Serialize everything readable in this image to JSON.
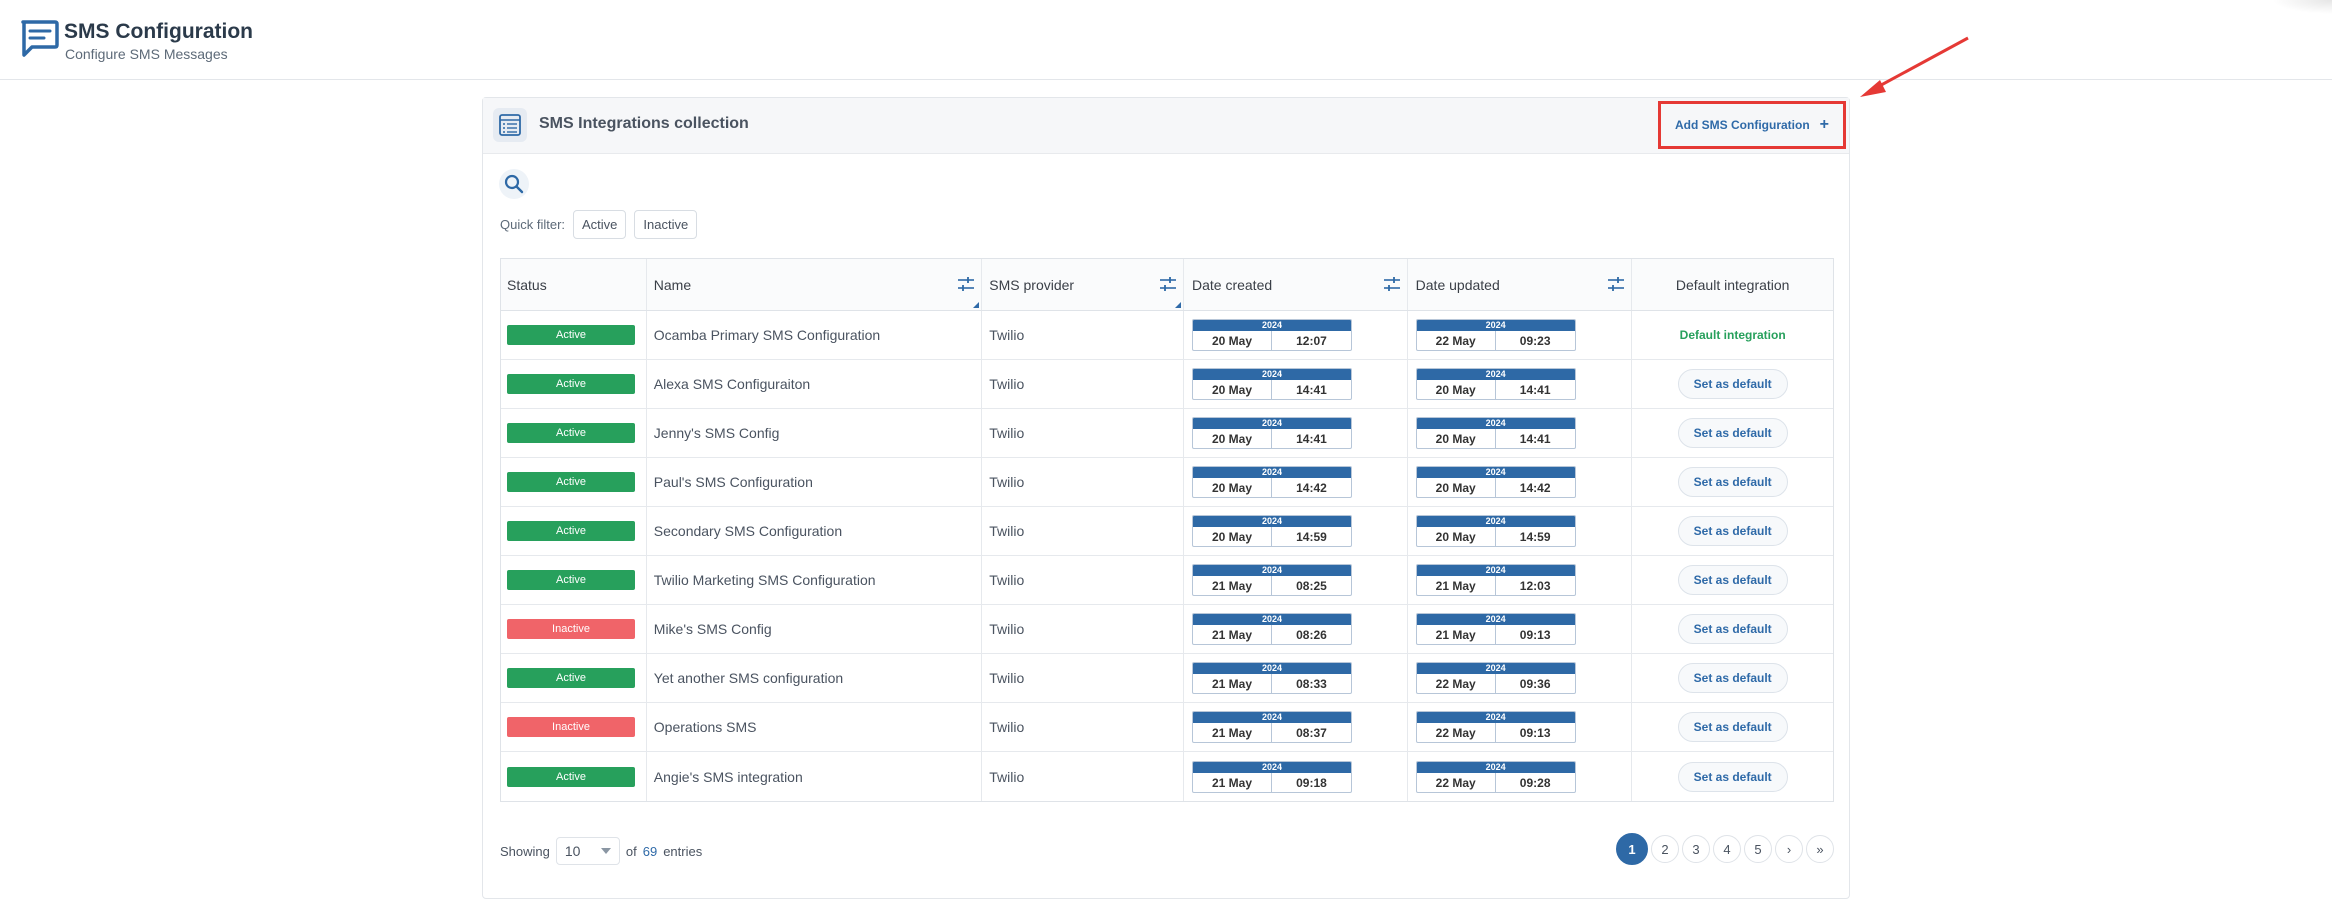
{
  "header": {
    "title": "SMS Configuration",
    "subtitle": "Configure SMS Messages"
  },
  "panel": {
    "title": "SMS Integrations collection",
    "add_button_label": "Add SMS Configuration",
    "quick_filter_label": "Quick filter:",
    "quick_filters": [
      "Active",
      "Inactive"
    ]
  },
  "table": {
    "columns": {
      "status": "Status",
      "name": "Name",
      "provider": "SMS provider",
      "created": "Date created",
      "updated": "Date updated",
      "default": "Default integration"
    },
    "rows": [
      {
        "status": "Active",
        "name": "Ocamba Primary SMS Configuration",
        "provider": "Twilio",
        "created": {
          "year": "2024",
          "day": "20 May",
          "time": "12:07"
        },
        "updated": {
          "year": "2024",
          "day": "22 May",
          "time": "09:23"
        },
        "is_default": true
      },
      {
        "status": "Active",
        "name": "Alexa SMS Configuraiton",
        "provider": "Twilio",
        "created": {
          "year": "2024",
          "day": "20 May",
          "time": "14:41"
        },
        "updated": {
          "year": "2024",
          "day": "20 May",
          "time": "14:41"
        },
        "is_default": false
      },
      {
        "status": "Active",
        "name": "Jenny's SMS Config",
        "provider": "Twilio",
        "created": {
          "year": "2024",
          "day": "20 May",
          "time": "14:41"
        },
        "updated": {
          "year": "2024",
          "day": "20 May",
          "time": "14:41"
        },
        "is_default": false
      },
      {
        "status": "Active",
        "name": "Paul's SMS Configuration",
        "provider": "Twilio",
        "created": {
          "year": "2024",
          "day": "20 May",
          "time": "14:42"
        },
        "updated": {
          "year": "2024",
          "day": "20 May",
          "time": "14:42"
        },
        "is_default": false
      },
      {
        "status": "Active",
        "name": "Secondary SMS Configuration",
        "provider": "Twilio",
        "created": {
          "year": "2024",
          "day": "20 May",
          "time": "14:59"
        },
        "updated": {
          "year": "2024",
          "day": "20 May",
          "time": "14:59"
        },
        "is_default": false
      },
      {
        "status": "Active",
        "name": "Twilio Marketing SMS Configuration",
        "provider": "Twilio",
        "created": {
          "year": "2024",
          "day": "21 May",
          "time": "08:25"
        },
        "updated": {
          "year": "2024",
          "day": "21 May",
          "time": "12:03"
        },
        "is_default": false
      },
      {
        "status": "Inactive",
        "name": "Mike's SMS Config",
        "provider": "Twilio",
        "created": {
          "year": "2024",
          "day": "21 May",
          "time": "08:26"
        },
        "updated": {
          "year": "2024",
          "day": "21 May",
          "time": "09:13"
        },
        "is_default": false
      },
      {
        "status": "Active",
        "name": "Yet another SMS configuration",
        "provider": "Twilio",
        "created": {
          "year": "2024",
          "day": "21 May",
          "time": "08:33"
        },
        "updated": {
          "year": "2024",
          "day": "22 May",
          "time": "09:36"
        },
        "is_default": false
      },
      {
        "status": "Inactive",
        "name": "Operations SMS",
        "provider": "Twilio",
        "created": {
          "year": "2024",
          "day": "21 May",
          "time": "08:37"
        },
        "updated": {
          "year": "2024",
          "day": "22 May",
          "time": "09:13"
        },
        "is_default": false
      },
      {
        "status": "Active",
        "name": "Angie's SMS integration",
        "provider": "Twilio",
        "created": {
          "year": "2024",
          "day": "21 May",
          "time": "09:18"
        },
        "updated": {
          "year": "2024",
          "day": "22 May",
          "time": "09:28"
        },
        "is_default": false
      }
    ],
    "default_label": "Default integration",
    "set_default_label": "Set as default"
  },
  "footer": {
    "showing_label": "Showing",
    "page_size": "10",
    "of_label": "of",
    "total": "69",
    "entries_label": "entries",
    "pages": [
      "1",
      "2",
      "3",
      "4",
      "5"
    ],
    "current_page": "1",
    "next_glyph": "›",
    "last_glyph": "»"
  },
  "colors": {
    "accent": "#2e69a6",
    "active": "#27a05c",
    "inactive": "#f06469",
    "highlight": "#e53935"
  }
}
